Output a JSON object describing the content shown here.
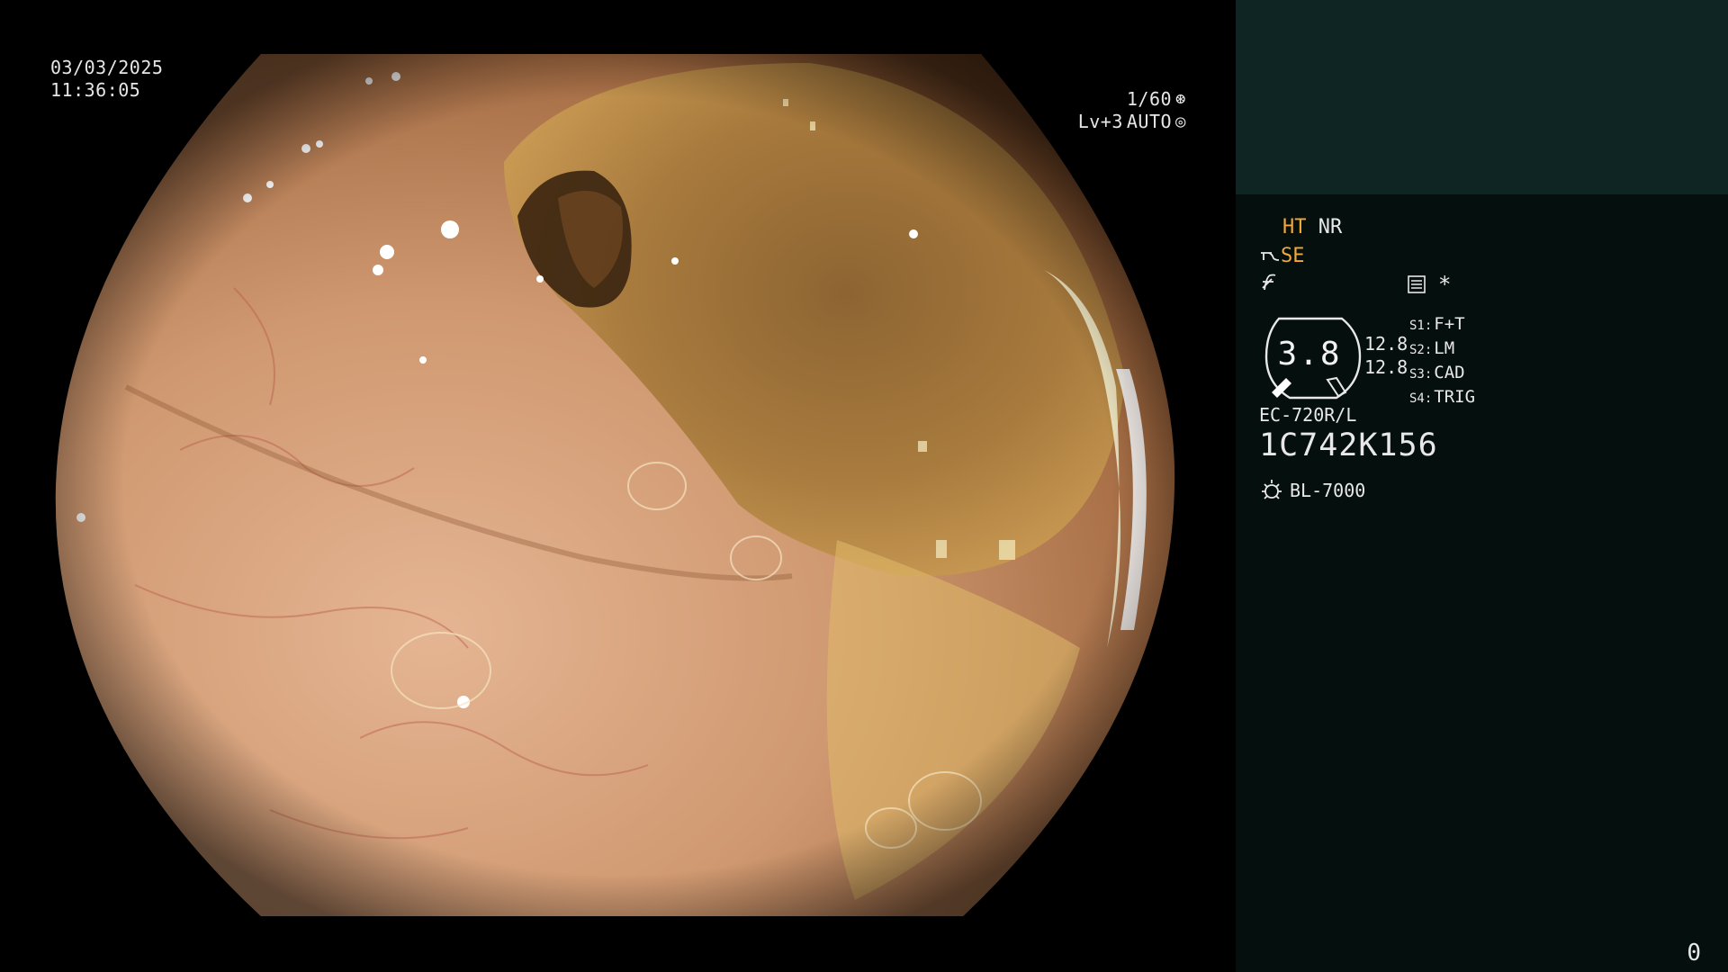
{
  "osd": {
    "date": "03/03/2025",
    "time": "11:36:05",
    "shutter": "1/60",
    "shutter_icon": "aperture-icon",
    "level": "Lv+3",
    "mode": "AUTO",
    "mode_icon": "iris-icon"
  },
  "panel": {
    "ht": "HT",
    "nr": "NR",
    "se": "SE",
    "se_icon": "structure-enhance-icon",
    "fn_icon": "freeze-icon",
    "menu_icon": "menu-list-icon",
    "star": "*",
    "gauge_value": "3.8",
    "gauge_readout_1": "12.8",
    "gauge_readout_2": "12.8",
    "modes": [
      {
        "key": "S1:",
        "value": "F+T"
      },
      {
        "key": "S2:",
        "value": "LM"
      },
      {
        "key": "S3:",
        "value": "CAD"
      },
      {
        "key": "S4:",
        "value": "TRIG"
      }
    ],
    "scope_model": "EC-720R/L",
    "serial": "1C742K156",
    "light_icon": "light-source-icon",
    "light_source": "BL-7000"
  },
  "counter": "0",
  "colors": {
    "panel_bg": "#050f0d",
    "panel_top": "#0f2523",
    "accent": "#f2a938",
    "tissue": "#c98f63"
  }
}
